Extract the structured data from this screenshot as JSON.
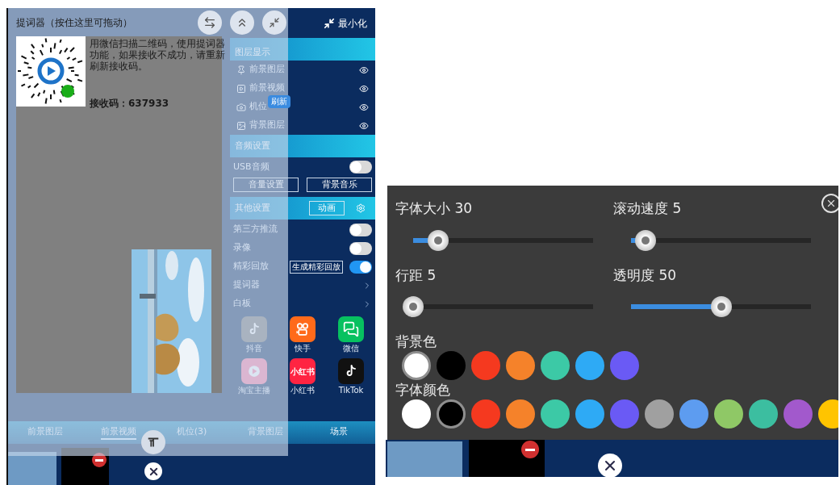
{
  "phone": {
    "minimize_label": "最小化",
    "layer_section": {
      "title": "图层显示",
      "layers": [
        {
          "label": "前景图层"
        },
        {
          "label": "前景视频"
        },
        {
          "label": "机位"
        },
        {
          "label": "背景图层"
        }
      ]
    },
    "audio_section": {
      "title": "音频设置",
      "usb": {
        "label": "USB音频",
        "on": false
      },
      "buttons": [
        "音量设置",
        "背景音乐"
      ]
    },
    "other_section": {
      "title": "其他设置",
      "button": "动画",
      "rows": [
        {
          "kind": "toggle",
          "label": "第三方推流",
          "on": false
        },
        {
          "kind": "toggle",
          "label": "录像",
          "on": false
        },
        {
          "kind": "toggle",
          "label": "精彩回放",
          "button": "生成精彩回放",
          "on": true
        },
        {
          "kind": "link",
          "label": "提词器"
        },
        {
          "kind": "link",
          "label": "白板"
        }
      ]
    },
    "apps": [
      {
        "label": "抖音"
      },
      {
        "label": "快手"
      },
      {
        "label": "微信"
      },
      {
        "label": "淘宝主播"
      },
      {
        "label": "小红书",
        "icon_text": "小红书"
      },
      {
        "label": "TikTok"
      }
    ],
    "tabs": [
      {
        "label": "前景图层",
        "selected": false
      },
      {
        "label": "前景视频",
        "selected": true
      },
      {
        "label": "机位(3)",
        "selected": false
      },
      {
        "label": "背景图层",
        "selected": false
      },
      {
        "label": "场景",
        "selected": false
      }
    ]
  },
  "teleprompter": {
    "title": "提词器（按住这里可拖动）",
    "message": "用微信扫描二维码，使用提词器功能，如果接收不成功，请重新刷新接收码。",
    "receive_code": "接收码：637933",
    "refresh": "刷新"
  },
  "settings": {
    "sliders": [
      {
        "label": "字体大小 30",
        "level": 0.14
      },
      {
        "label": "滚动速度 5",
        "level": 0.08
      },
      {
        "label": "行距 5",
        "level": 0.0
      },
      {
        "label": "透明度 50",
        "level": 0.5
      }
    ],
    "background_color": {
      "label": "背景色",
      "swatches": [
        {
          "color": "#ffffff",
          "selected": true
        },
        {
          "color": "#000000",
          "selected": false
        },
        {
          "color": "#f5391f",
          "selected": false
        },
        {
          "color": "#f5822a",
          "selected": false
        },
        {
          "color": "#3cc9a6",
          "selected": false
        },
        {
          "color": "#2eaaf5",
          "selected": false
        },
        {
          "color": "#6a5af5",
          "selected": false
        }
      ]
    },
    "font_color": {
      "label": "字体颜色",
      "swatches": [
        {
          "color": "#ffffff",
          "selected": false
        },
        {
          "color": "#000000",
          "selected": true
        },
        {
          "color": "#f5391f",
          "selected": false
        },
        {
          "color": "#f5822a",
          "selected": false
        },
        {
          "color": "#3cc9a6",
          "selected": false
        },
        {
          "color": "#2eaaf5",
          "selected": false
        },
        {
          "color": "#6a5af5",
          "selected": false
        },
        {
          "color": "#a0a0a0",
          "selected": false
        },
        {
          "color": "#5d9cf0",
          "selected": false
        },
        {
          "color": "#8fc866",
          "selected": false
        },
        {
          "color": "#3cbea0",
          "selected": false
        },
        {
          "color": "#a259cc",
          "selected": false
        },
        {
          "color": "#ffc400",
          "selected": false
        }
      ]
    }
  }
}
